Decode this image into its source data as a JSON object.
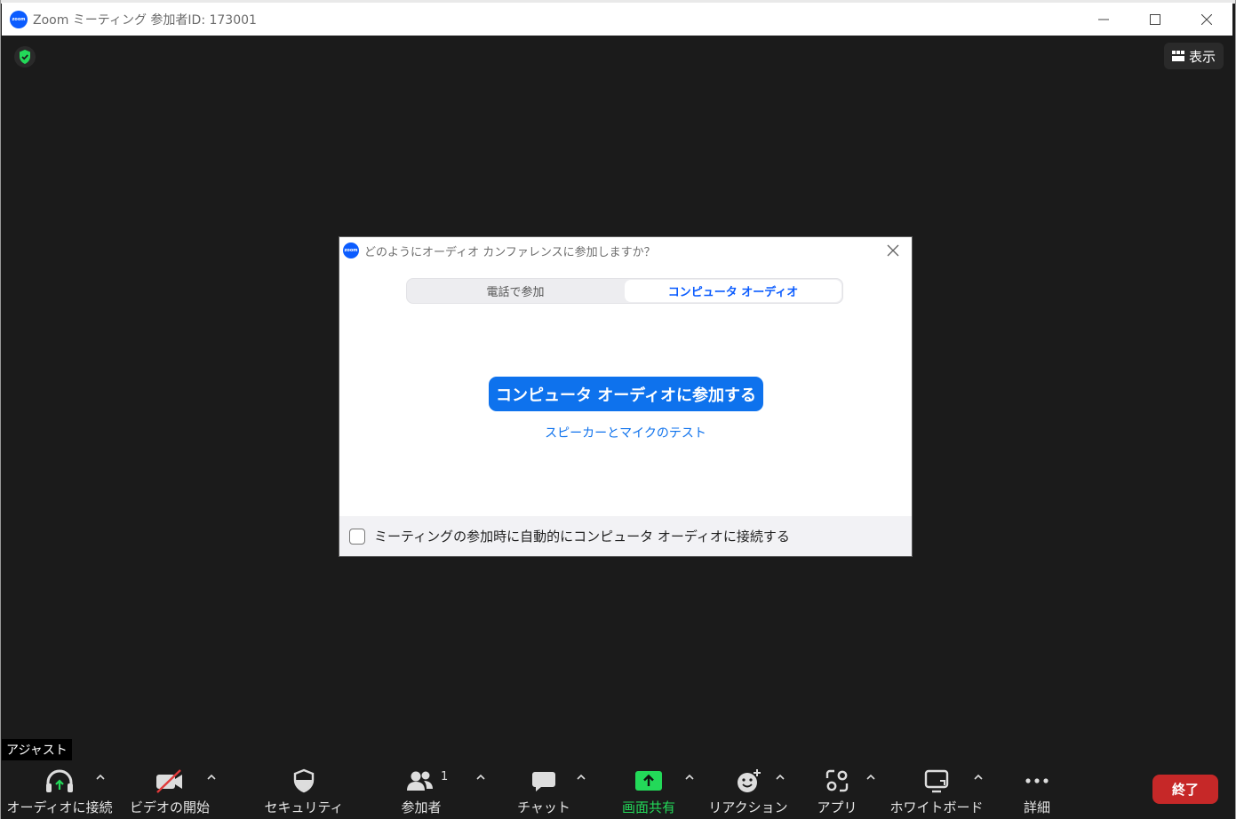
{
  "window": {
    "title": "Zoom ミーティング 参加者ID: 173001",
    "logo_text": "zoom",
    "controls": [
      "minimize",
      "maximize",
      "close"
    ]
  },
  "video": {
    "view_button": "表示"
  },
  "dialog": {
    "title": "どのようにオーディオ カンファレンスに参加しますか？",
    "logo_text": "zoom",
    "tabs": [
      {
        "label": "電話で参加",
        "active": false
      },
      {
        "label": "コンピュータ オーディオ",
        "active": true
      }
    ],
    "join_button": "コンピュータ オーディオに参加する",
    "test_link": "スピーカーとマイクのテスト",
    "auto_connect": {
      "label": "ミーティングの参加時に自動的にコンピュータ オーディオに接続する",
      "checked": false
    }
  },
  "assist_label": "アジャスト",
  "toolbar": {
    "items": [
      {
        "label": "オーディオに接続",
        "icon": "headphones-icon"
      },
      {
        "label": "ビデオの開始",
        "icon": "video-off-icon"
      },
      {
        "label": "セキュリティ",
        "icon": "shield-icon"
      },
      {
        "label": "参加者",
        "icon": "participants-icon",
        "count": "1"
      },
      {
        "label": "チャット",
        "icon": "chat-icon"
      },
      {
        "label": "画面共有",
        "icon": "share-screen-icon"
      },
      {
        "label": "リアクション",
        "icon": "reaction-icon"
      },
      {
        "label": "アプリ",
        "icon": "apps-icon"
      },
      {
        "label": "ホワイトボード",
        "icon": "whiteboard-icon"
      },
      {
        "label": "詳細",
        "icon": "more-icon"
      }
    ],
    "end_button": "終了"
  },
  "colors": {
    "accent": "#0e72ed",
    "share_green": "#23d959",
    "end_red": "#c62828",
    "background": "#1b1b1b"
  }
}
